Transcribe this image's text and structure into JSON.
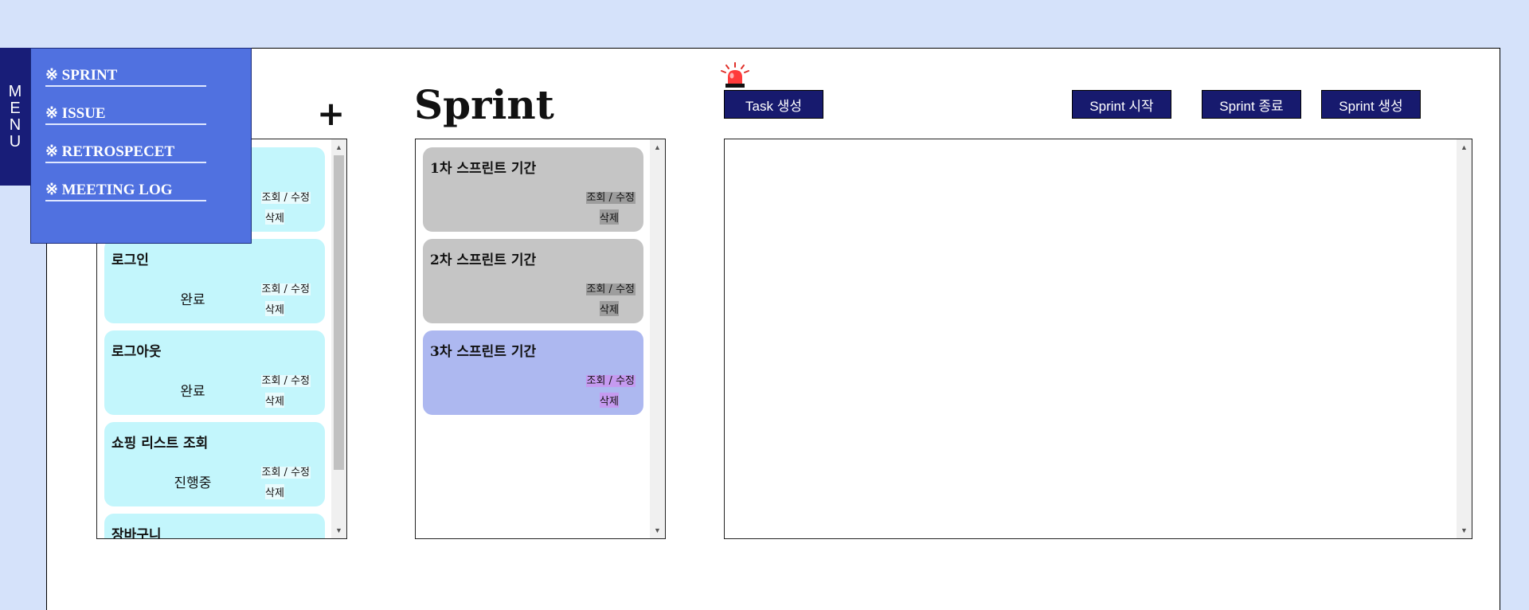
{
  "menu": {
    "tab_letters": [
      "M",
      "E",
      "N",
      "U"
    ],
    "items": [
      {
        "label": "※ SPRINT"
      },
      {
        "label": "※ ISSUE"
      },
      {
        "label": "※ RETROSPECET"
      },
      {
        "label": "※ MEETING LOG"
      }
    ]
  },
  "toolbar": {
    "plus_label": "+",
    "page_title": "Sprint",
    "task_create": "Task 생성",
    "sprint_start": "Sprint 시작",
    "sprint_end": "Sprint 종료",
    "sprint_create": "Sprint 생성"
  },
  "tasks": [
    {
      "title": "",
      "status": "",
      "view_edit": "조회 / 수정",
      "delete": "삭제"
    },
    {
      "title": "로그인",
      "status": "완료",
      "view_edit": "조회 / 수정",
      "delete": "삭제"
    },
    {
      "title": "로그아웃",
      "status": "완료",
      "view_edit": "조회 / 수정",
      "delete": "삭제"
    },
    {
      "title": "쇼핑 리스트 조회",
      "status": "진행중",
      "view_edit": "조회 / 수정",
      "delete": "삭제"
    },
    {
      "title": "장바구니",
      "status": "",
      "view_edit": "",
      "delete": ""
    }
  ],
  "sprints": [
    {
      "title": "1차 스프린트 기간",
      "view_edit": "조회 / 수정",
      "delete": "삭제",
      "state": "inactive"
    },
    {
      "title": "2차 스프린트 기간",
      "view_edit": "조회 / 수정",
      "delete": "삭제",
      "state": "inactive"
    },
    {
      "title": "3차 스프린트 기간",
      "view_edit": "조회 / 수정",
      "delete": "삭제",
      "state": "active"
    }
  ],
  "colors": {
    "background": "#d5e2fa",
    "menu_tab": "#181d78",
    "menu_panel": "#5071e0",
    "button": "#171a6e",
    "task_card": "#c3f6fc",
    "sprint_inactive": "#c5c5c5",
    "sprint_active": "#adb8f0"
  },
  "icons": {
    "alert": "siren-icon"
  }
}
